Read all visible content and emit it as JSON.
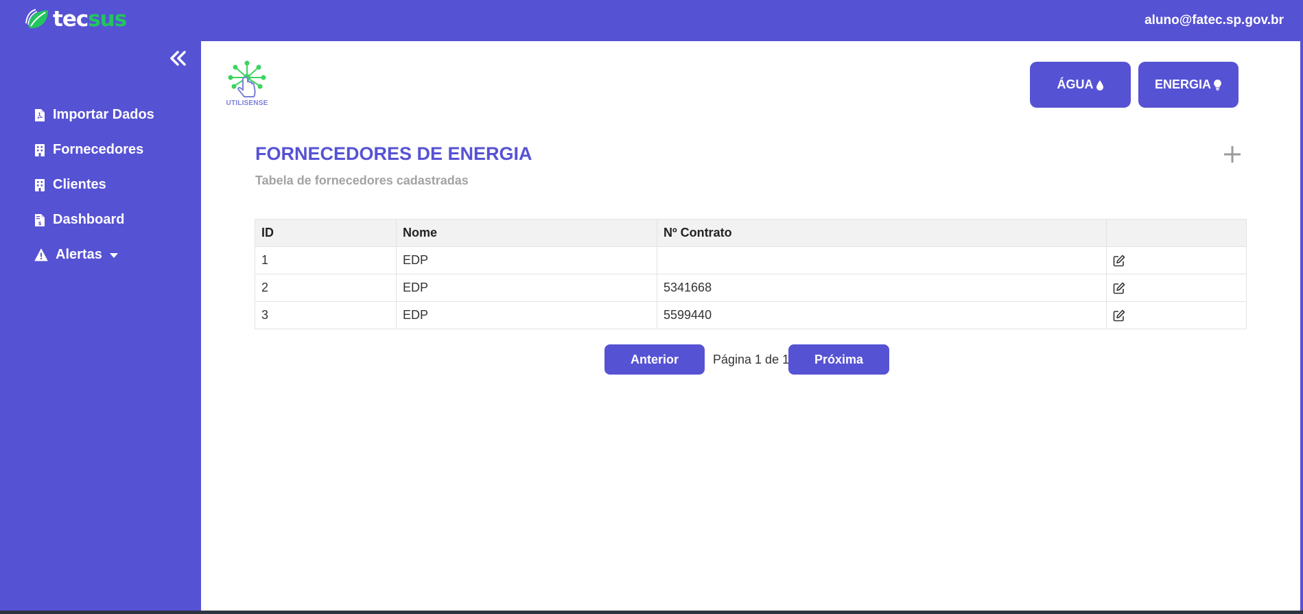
{
  "header": {
    "logo_text_1": "tec",
    "logo_text_2": "sus",
    "user_email": "aluno@fatec.sp.gov.br"
  },
  "sidebar": {
    "items": [
      {
        "label": "Importar Dados",
        "icon": "file-pdf-icon"
      },
      {
        "label": "Fornecedores",
        "icon": "building-icon"
      },
      {
        "label": "Clientes",
        "icon": "building-icon"
      },
      {
        "label": "Dashboard",
        "icon": "file-invoice-dollar-icon"
      },
      {
        "label": "Alertas",
        "icon": "warning-icon"
      }
    ]
  },
  "brand": {
    "name": "UTILISENSE"
  },
  "buttons": {
    "agua": "ÁGUA",
    "energia": "ENERGIA"
  },
  "main": {
    "title": "FORNECEDORES DE ENERGIA",
    "subtitle": "Tabela de fornecedores cadastradas"
  },
  "table": {
    "headers": [
      "ID",
      "Nome",
      "Nº Contrato",
      ""
    ],
    "rows": [
      {
        "id": "1",
        "nome": "EDP",
        "contrato": ""
      },
      {
        "id": "2",
        "nome": "EDP",
        "contrato": "5341668"
      },
      {
        "id": "3",
        "nome": "EDP",
        "contrato": "5599440"
      }
    ]
  },
  "pagination": {
    "prev": "Anterior",
    "info": "Página 1 de 1",
    "next": "Próxima"
  },
  "colors": {
    "primary": "#5652d4",
    "accent_green": "#22c55e",
    "subtitle_gray": "#a3a3a3"
  }
}
